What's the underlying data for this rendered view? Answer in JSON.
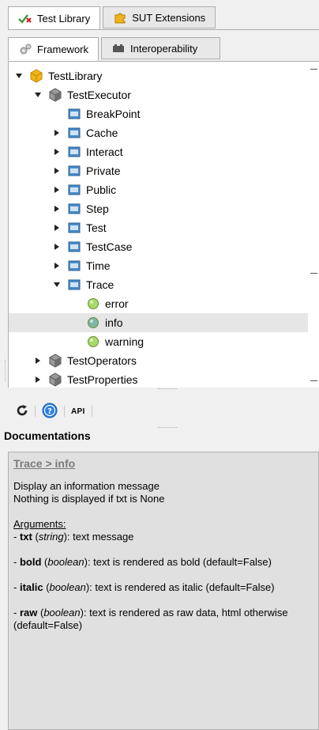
{
  "tabs_top": [
    {
      "label": "Test Library",
      "icon": "test-library-icon",
      "active": true
    },
    {
      "label": "SUT Extensions",
      "icon": "puzzle-icon",
      "active": false
    }
  ],
  "tabs_sub": [
    {
      "label": "Framework",
      "icon": "gears-icon",
      "active": true
    },
    {
      "label": "Interoperability",
      "icon": "plugins-icon",
      "active": false
    }
  ],
  "tree": [
    {
      "label": "TestLibrary",
      "level": 0,
      "expander": "expanded",
      "icon": "package",
      "selected": false
    },
    {
      "label": "TestExecutor",
      "level": 1,
      "expander": "expanded",
      "icon": "cube",
      "selected": false
    },
    {
      "label": "BreakPoint",
      "level": 2,
      "expander": "none",
      "icon": "class",
      "selected": false
    },
    {
      "label": "Cache",
      "level": 2,
      "expander": "collapsed",
      "icon": "class",
      "selected": false
    },
    {
      "label": "Interact",
      "level": 2,
      "expander": "collapsed",
      "icon": "class",
      "selected": false
    },
    {
      "label": "Private",
      "level": 2,
      "expander": "collapsed",
      "icon": "class",
      "selected": false
    },
    {
      "label": "Public",
      "level": 2,
      "expander": "collapsed",
      "icon": "class",
      "selected": false
    },
    {
      "label": "Step",
      "level": 2,
      "expander": "collapsed",
      "icon": "class",
      "selected": false
    },
    {
      "label": "Test",
      "level": 2,
      "expander": "collapsed",
      "icon": "class",
      "selected": false
    },
    {
      "label": "TestCase",
      "level": 2,
      "expander": "collapsed",
      "icon": "class",
      "selected": false
    },
    {
      "label": "Time",
      "level": 2,
      "expander": "collapsed",
      "icon": "class",
      "selected": false
    },
    {
      "label": "Trace",
      "level": 2,
      "expander": "expanded",
      "icon": "class",
      "selected": false
    },
    {
      "label": "error",
      "level": 3,
      "expander": "none",
      "icon": "method",
      "selected": false
    },
    {
      "label": "info",
      "level": 3,
      "expander": "none",
      "icon": "method",
      "selected": true
    },
    {
      "label": "warning",
      "level": 3,
      "expander": "none",
      "icon": "method",
      "selected": false
    },
    {
      "label": "TestOperators",
      "level": 1,
      "expander": "collapsed",
      "icon": "cube",
      "selected": false
    },
    {
      "label": "TestProperties",
      "level": 1,
      "expander": "collapsed",
      "icon": "cube",
      "selected": false
    }
  ],
  "toolbar": {
    "refresh_icon": "refresh-icon",
    "help_icon": "help-icon",
    "api_label": "API"
  },
  "documentation": {
    "title": "Documentations",
    "breadcrumb": "Trace > info",
    "description_lines": [
      "Display an information message",
      "Nothing is displayed if txt is None"
    ],
    "arguments_title": "Arguments:",
    "arguments": [
      {
        "prefix": "- ",
        "name": "txt",
        "type": "string",
        "desc": ": text message"
      },
      {
        "prefix": "- ",
        "name": "bold",
        "type": "boolean",
        "desc": ": text is rendered as bold (default=False)"
      },
      {
        "prefix": "- ",
        "name": "italic",
        "type": "boolean",
        "desc": ": text is rendered as italic (default=False)"
      },
      {
        "prefix": "- ",
        "name": "raw",
        "type": "boolean",
        "desc": ": text is rendered as raw data, html otherwise (default=False)"
      }
    ]
  },
  "colors": {
    "selection": "#e6e6e6",
    "class_icon": "#4a8cc9",
    "method_icon_green": "#a8d86a",
    "method_icon_blue": "#7fb5a8",
    "package_icon": "#f0b41a"
  }
}
